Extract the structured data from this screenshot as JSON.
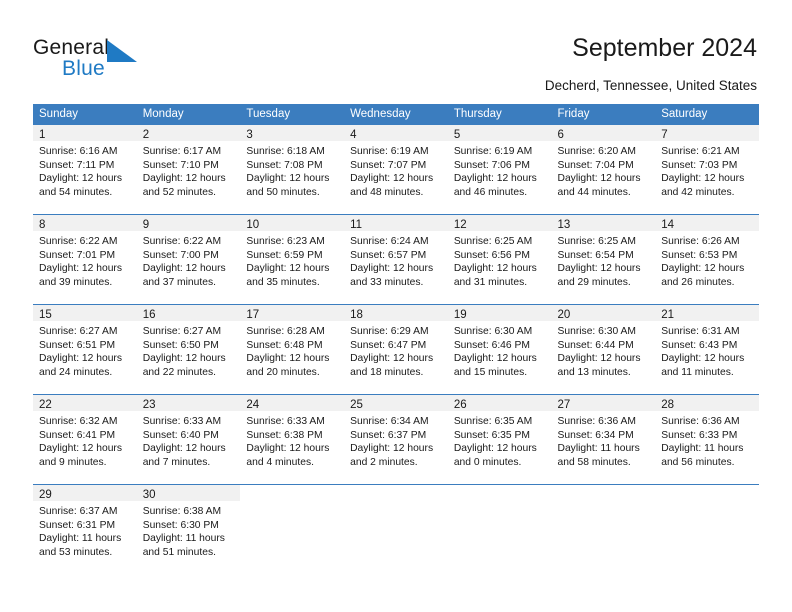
{
  "brand": {
    "name_part1": "General",
    "name_part2": "Blue",
    "accent_color": "#1f7ac4",
    "logo_icon": "sail-triangle-icon"
  },
  "header": {
    "title": "September 2024",
    "location": "Decherd, Tennessee, United States"
  },
  "calendar": {
    "header_bg": "#3b7dbf",
    "daynum_bg": "#f1f1f1",
    "weekdays": [
      "Sunday",
      "Monday",
      "Tuesday",
      "Wednesday",
      "Thursday",
      "Friday",
      "Saturday"
    ],
    "weeks": [
      [
        {
          "day": "1",
          "sunrise": "Sunrise: 6:16 AM",
          "sunset": "Sunset: 7:11 PM",
          "daylight1": "Daylight: 12 hours",
          "daylight2": "and 54 minutes."
        },
        {
          "day": "2",
          "sunrise": "Sunrise: 6:17 AM",
          "sunset": "Sunset: 7:10 PM",
          "daylight1": "Daylight: 12 hours",
          "daylight2": "and 52 minutes."
        },
        {
          "day": "3",
          "sunrise": "Sunrise: 6:18 AM",
          "sunset": "Sunset: 7:08 PM",
          "daylight1": "Daylight: 12 hours",
          "daylight2": "and 50 minutes."
        },
        {
          "day": "4",
          "sunrise": "Sunrise: 6:19 AM",
          "sunset": "Sunset: 7:07 PM",
          "daylight1": "Daylight: 12 hours",
          "daylight2": "and 48 minutes."
        },
        {
          "day": "5",
          "sunrise": "Sunrise: 6:19 AM",
          "sunset": "Sunset: 7:06 PM",
          "daylight1": "Daylight: 12 hours",
          "daylight2": "and 46 minutes."
        },
        {
          "day": "6",
          "sunrise": "Sunrise: 6:20 AM",
          "sunset": "Sunset: 7:04 PM",
          "daylight1": "Daylight: 12 hours",
          "daylight2": "and 44 minutes."
        },
        {
          "day": "7",
          "sunrise": "Sunrise: 6:21 AM",
          "sunset": "Sunset: 7:03 PM",
          "daylight1": "Daylight: 12 hours",
          "daylight2": "and 42 minutes."
        }
      ],
      [
        {
          "day": "8",
          "sunrise": "Sunrise: 6:22 AM",
          "sunset": "Sunset: 7:01 PM",
          "daylight1": "Daylight: 12 hours",
          "daylight2": "and 39 minutes."
        },
        {
          "day": "9",
          "sunrise": "Sunrise: 6:22 AM",
          "sunset": "Sunset: 7:00 PM",
          "daylight1": "Daylight: 12 hours",
          "daylight2": "and 37 minutes."
        },
        {
          "day": "10",
          "sunrise": "Sunrise: 6:23 AM",
          "sunset": "Sunset: 6:59 PM",
          "daylight1": "Daylight: 12 hours",
          "daylight2": "and 35 minutes."
        },
        {
          "day": "11",
          "sunrise": "Sunrise: 6:24 AM",
          "sunset": "Sunset: 6:57 PM",
          "daylight1": "Daylight: 12 hours",
          "daylight2": "and 33 minutes."
        },
        {
          "day": "12",
          "sunrise": "Sunrise: 6:25 AM",
          "sunset": "Sunset: 6:56 PM",
          "daylight1": "Daylight: 12 hours",
          "daylight2": "and 31 minutes."
        },
        {
          "day": "13",
          "sunrise": "Sunrise: 6:25 AM",
          "sunset": "Sunset: 6:54 PM",
          "daylight1": "Daylight: 12 hours",
          "daylight2": "and 29 minutes."
        },
        {
          "day": "14",
          "sunrise": "Sunrise: 6:26 AM",
          "sunset": "Sunset: 6:53 PM",
          "daylight1": "Daylight: 12 hours",
          "daylight2": "and 26 minutes."
        }
      ],
      [
        {
          "day": "15",
          "sunrise": "Sunrise: 6:27 AM",
          "sunset": "Sunset: 6:51 PM",
          "daylight1": "Daylight: 12 hours",
          "daylight2": "and 24 minutes."
        },
        {
          "day": "16",
          "sunrise": "Sunrise: 6:27 AM",
          "sunset": "Sunset: 6:50 PM",
          "daylight1": "Daylight: 12 hours",
          "daylight2": "and 22 minutes."
        },
        {
          "day": "17",
          "sunrise": "Sunrise: 6:28 AM",
          "sunset": "Sunset: 6:48 PM",
          "daylight1": "Daylight: 12 hours",
          "daylight2": "and 20 minutes."
        },
        {
          "day": "18",
          "sunrise": "Sunrise: 6:29 AM",
          "sunset": "Sunset: 6:47 PM",
          "daylight1": "Daylight: 12 hours",
          "daylight2": "and 18 minutes."
        },
        {
          "day": "19",
          "sunrise": "Sunrise: 6:30 AM",
          "sunset": "Sunset: 6:46 PM",
          "daylight1": "Daylight: 12 hours",
          "daylight2": "and 15 minutes."
        },
        {
          "day": "20",
          "sunrise": "Sunrise: 6:30 AM",
          "sunset": "Sunset: 6:44 PM",
          "daylight1": "Daylight: 12 hours",
          "daylight2": "and 13 minutes."
        },
        {
          "day": "21",
          "sunrise": "Sunrise: 6:31 AM",
          "sunset": "Sunset: 6:43 PM",
          "daylight1": "Daylight: 12 hours",
          "daylight2": "and 11 minutes."
        }
      ],
      [
        {
          "day": "22",
          "sunrise": "Sunrise: 6:32 AM",
          "sunset": "Sunset: 6:41 PM",
          "daylight1": "Daylight: 12 hours",
          "daylight2": "and 9 minutes."
        },
        {
          "day": "23",
          "sunrise": "Sunrise: 6:33 AM",
          "sunset": "Sunset: 6:40 PM",
          "daylight1": "Daylight: 12 hours",
          "daylight2": "and 7 minutes."
        },
        {
          "day": "24",
          "sunrise": "Sunrise: 6:33 AM",
          "sunset": "Sunset: 6:38 PM",
          "daylight1": "Daylight: 12 hours",
          "daylight2": "and 4 minutes."
        },
        {
          "day": "25",
          "sunrise": "Sunrise: 6:34 AM",
          "sunset": "Sunset: 6:37 PM",
          "daylight1": "Daylight: 12 hours",
          "daylight2": "and 2 minutes."
        },
        {
          "day": "26",
          "sunrise": "Sunrise: 6:35 AM",
          "sunset": "Sunset: 6:35 PM",
          "daylight1": "Daylight: 12 hours",
          "daylight2": "and 0 minutes."
        },
        {
          "day": "27",
          "sunrise": "Sunrise: 6:36 AM",
          "sunset": "Sunset: 6:34 PM",
          "daylight1": "Daylight: 11 hours",
          "daylight2": "and 58 minutes."
        },
        {
          "day": "28",
          "sunrise": "Sunrise: 6:36 AM",
          "sunset": "Sunset: 6:33 PM",
          "daylight1": "Daylight: 11 hours",
          "daylight2": "and 56 minutes."
        }
      ],
      [
        {
          "day": "29",
          "sunrise": "Sunrise: 6:37 AM",
          "sunset": "Sunset: 6:31 PM",
          "daylight1": "Daylight: 11 hours",
          "daylight2": "and 53 minutes."
        },
        {
          "day": "30",
          "sunrise": "Sunrise: 6:38 AM",
          "sunset": "Sunset: 6:30 PM",
          "daylight1": "Daylight: 11 hours",
          "daylight2": "and 51 minutes."
        },
        {
          "day": "",
          "sunrise": "",
          "sunset": "",
          "daylight1": "",
          "daylight2": ""
        },
        {
          "day": "",
          "sunrise": "",
          "sunset": "",
          "daylight1": "",
          "daylight2": ""
        },
        {
          "day": "",
          "sunrise": "",
          "sunset": "",
          "daylight1": "",
          "daylight2": ""
        },
        {
          "day": "",
          "sunrise": "",
          "sunset": "",
          "daylight1": "",
          "daylight2": ""
        },
        {
          "day": "",
          "sunrise": "",
          "sunset": "",
          "daylight1": "",
          "daylight2": ""
        }
      ]
    ]
  }
}
